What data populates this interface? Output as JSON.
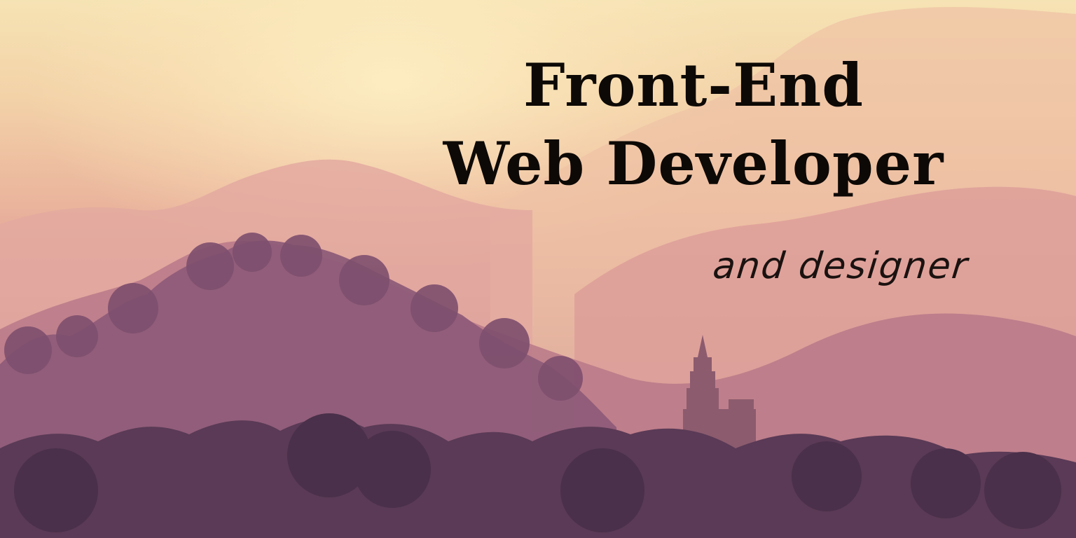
{
  "headline": {
    "line1": "Front-End",
    "line2": "Web Developer"
  },
  "tagline": "and designer",
  "palette": {
    "sky_top": "#f6e3b4",
    "sky_mid": "#eab49c",
    "ridge_far": "#e3a7a0",
    "ridge_mid": "#c48290",
    "hill_near": "#8a5a78",
    "foreground": "#4e3350",
    "text": "#0d0906"
  }
}
